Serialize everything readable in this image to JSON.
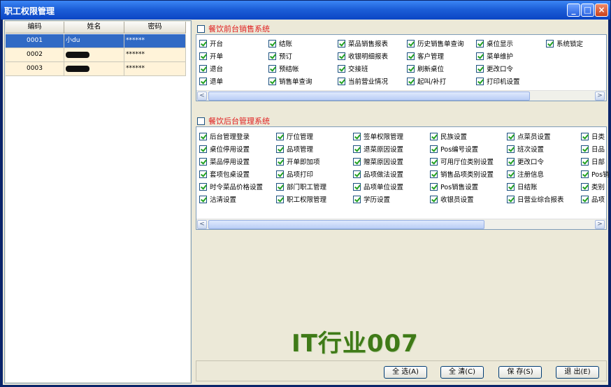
{
  "window": {
    "title": "职工权限管理",
    "min_glyph": "_",
    "max_glyph": "□",
    "close_glyph": "×"
  },
  "users": {
    "headers": [
      "编码",
      "姓名",
      "密码"
    ],
    "rows": [
      {
        "code": "0001",
        "name": "小du",
        "password": "******",
        "selected": true
      },
      {
        "code": "0002",
        "name": "",
        "password": "******",
        "selected": false
      },
      {
        "code": "0003",
        "name": "",
        "password": "******",
        "selected": false
      }
    ]
  },
  "front": {
    "label": "餐饮前台销售系统",
    "items": [
      "开台",
      "结账",
      "菜品销售报表",
      "历史销售单查询",
      "桌位显示",
      "系统锁定",
      "开单",
      "预订",
      "收银明细报表",
      "客户管理",
      "菜单维护",
      "退台",
      "预结帐",
      "交接班",
      "刷新桌位",
      "更改口令",
      "退单",
      "销售单查询",
      "当前营业情况",
      "起叫/补打",
      "打印机设置"
    ]
  },
  "back": {
    "label": "餐饮后台管理系统",
    "items": [
      "后台管理登录",
      "厅位管理",
      "签单权限管理",
      "民族设置",
      "点菜员设置",
      "日类",
      "桌位停用设置",
      "品项管理",
      "退菜原因设置",
      "Pos编号设置",
      "班次设置",
      "日品",
      "菜品停用设置",
      "开单即加项",
      "赠菜原因设置",
      "可用厅位类别设置",
      "更改口令",
      "日部",
      "套项包桌设置",
      "品项打印",
      "品项做法设置",
      "销售品项类别设置",
      "注册信息",
      "Pos销",
      "时令菜品价格设置",
      "部门职工管理",
      "品项单位设置",
      "Pos销售设置",
      "日结账",
      "类别",
      "沽清设置",
      "职工权限管理",
      "学历设置",
      "收银员设置",
      "日营业综合报表",
      "品项"
    ]
  },
  "scroll": {
    "left": "<",
    "right": ">"
  },
  "watermark": "IT行业007",
  "buttons": {
    "select_all": "全 选(A)",
    "clear_all": "全 清(C)",
    "save": "保 存(S)",
    "exit": "退 出(E)"
  }
}
